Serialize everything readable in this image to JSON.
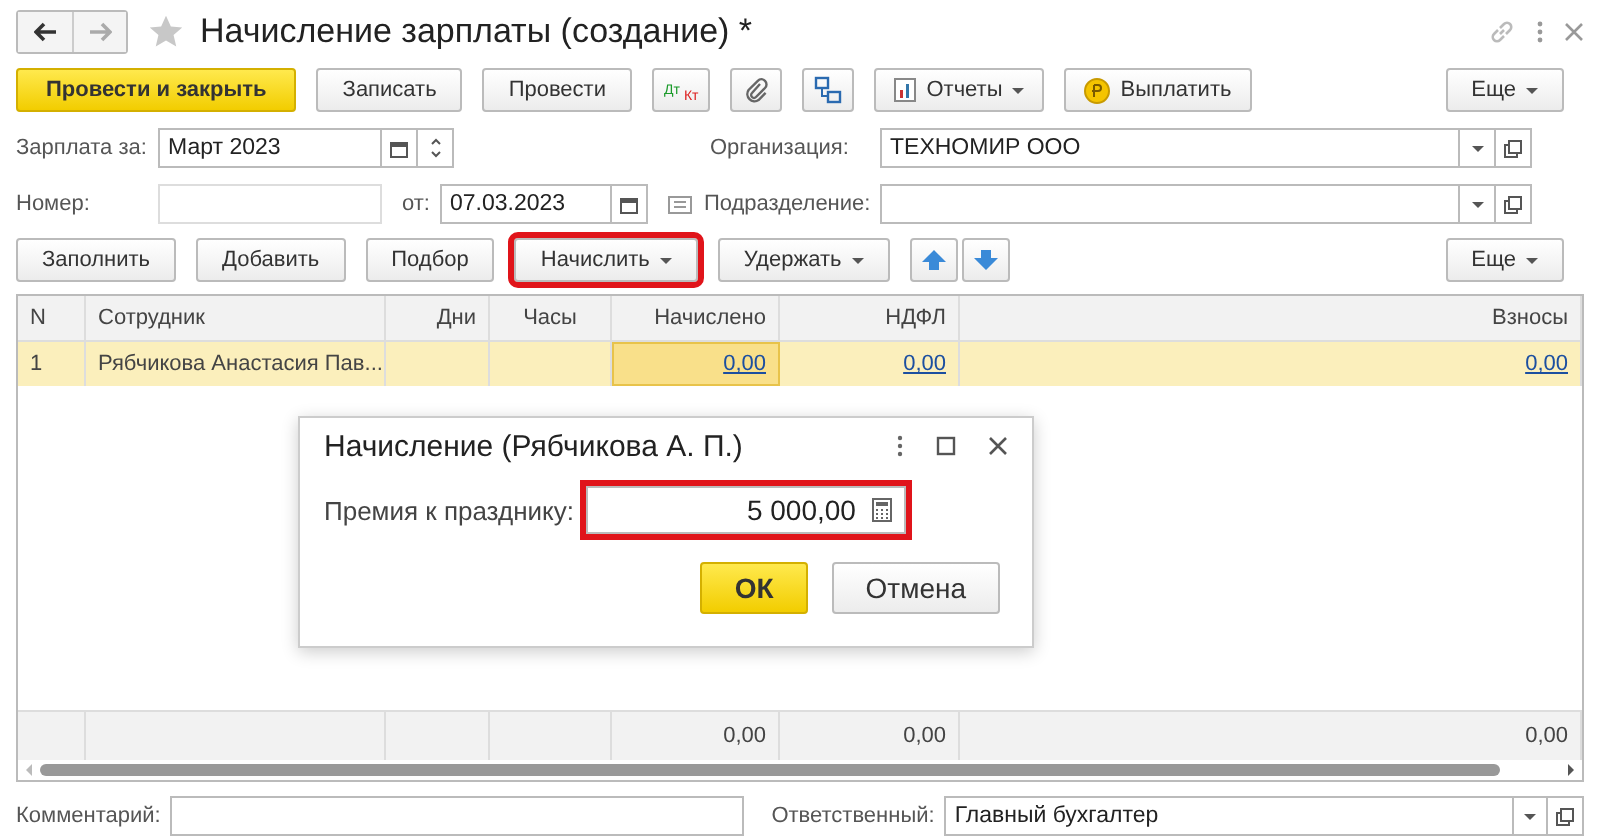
{
  "window": {
    "title": "Начисление зарплаты (создание) *"
  },
  "toolbar": [
    {
      "kind": "primary",
      "label": "Провести и закрыть"
    },
    {
      "kind": "plain",
      "label": "Записать"
    },
    {
      "kind": "plain",
      "label": "Провести"
    },
    {
      "kind": "dtkt",
      "top": "Дт",
      "bottom": "Кт"
    },
    {
      "kind": "paperclip"
    },
    {
      "kind": "structure"
    },
    {
      "kind": "reports",
      "label": "Отчеты"
    },
    {
      "kind": "pay",
      "label": "Выплатить"
    }
  ],
  "more_label": "Еще",
  "header_fields": {
    "salary_for": {
      "label": "Зарплата за:",
      "value": "Март 2023"
    },
    "organization": {
      "label": "Организация:",
      "value": "ТЕХНОМИР ООО"
    },
    "number": {
      "label": "Номер:"
    },
    "date": {
      "label": "от:",
      "value": "07.03.2023"
    },
    "department": {
      "label": "Подразделение:"
    }
  },
  "table_toolbar": [
    {
      "kind": "plain",
      "label": "Заполнить",
      "highlighted": false
    },
    {
      "kind": "plain",
      "label": "Добавить",
      "highlighted": false
    },
    {
      "kind": "plain",
      "label": "Подбор",
      "highlighted": false
    },
    {
      "kind": "menu",
      "label": "Начислить",
      "highlighted": true
    },
    {
      "kind": "menu",
      "label": "Удержать",
      "highlighted": false
    },
    {
      "kind": "up"
    },
    {
      "kind": "down"
    }
  ],
  "table_more_label": "Еще",
  "table": {
    "columns": [
      "N",
      "Сотрудник",
      "Дни",
      "Часы",
      "Начислено",
      "НДФЛ",
      "Взносы"
    ],
    "rows": [
      {
        "selected": true,
        "cells": [
          {
            "text": "1",
            "link": false,
            "active": false
          },
          {
            "text": "Рябчикова Анастасия Пав...",
            "link": false,
            "active": false
          },
          null,
          null,
          {
            "text": "0,00",
            "link": true,
            "active": true
          },
          {
            "text": "0,00",
            "link": true,
            "active": false
          },
          {
            "text": "0,00",
            "link": true,
            "active": false
          }
        ]
      }
    ],
    "totals": {
      "accrued": "0,00",
      "personal_income_tax": "0,00",
      "contributions": "0,00"
    }
  },
  "dialog": {
    "title": "Начисление (Рябчикова А. П.)",
    "field_label": "Премия к празднику:",
    "field_value": "5 000,00",
    "field_highlighted": true,
    "buttons": [
      {
        "kind": "primary",
        "label": "ОК"
      },
      {
        "kind": "plain",
        "label": "Отмена"
      }
    ]
  },
  "footer": {
    "comment": {
      "label": "Комментарий:"
    },
    "responsible": {
      "label": "Ответственный:",
      "value": "Главный бухгалтер"
    }
  }
}
